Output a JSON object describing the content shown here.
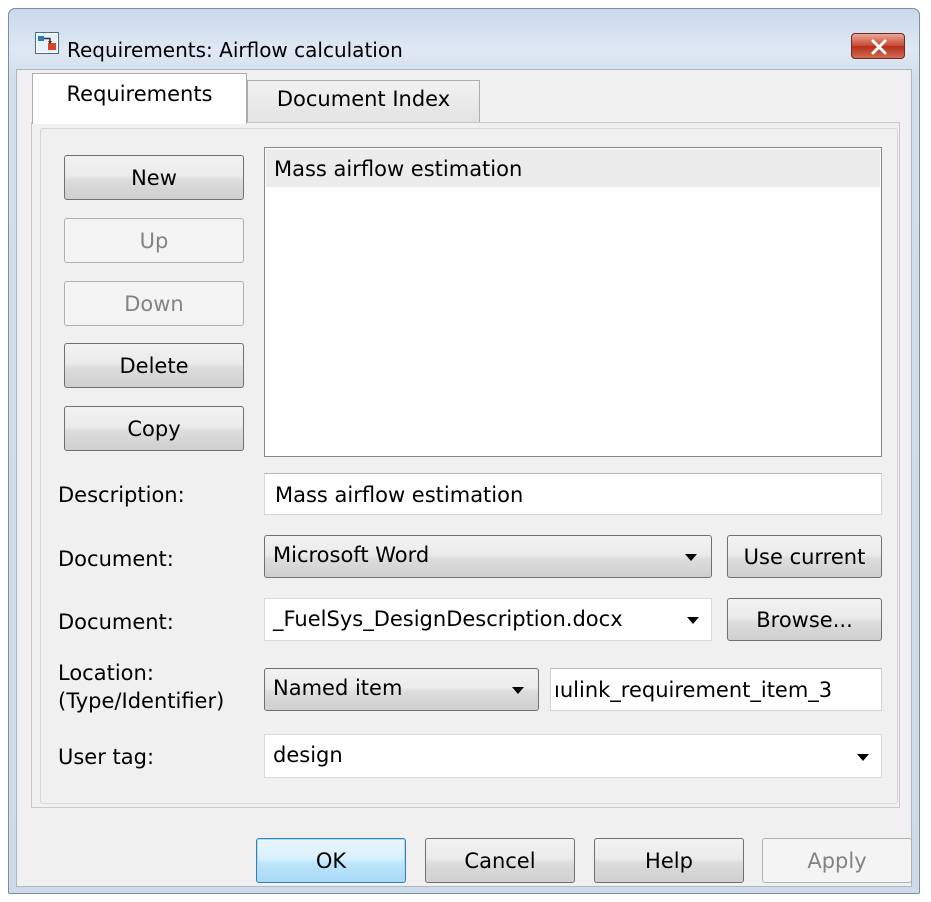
{
  "window": {
    "title": "Requirements: Airflow calculation",
    "close_icon": "close-icon",
    "app_icon": "simulink-model-icon"
  },
  "tabs": [
    {
      "label": "Requirements",
      "active": true
    },
    {
      "label": "Document Index",
      "active": false
    }
  ],
  "side_buttons": {
    "new": "New",
    "up": "Up",
    "down": "Down",
    "delete": "Delete",
    "copy": "Copy"
  },
  "requirements_list": {
    "items": [
      "Mass airflow estimation"
    ],
    "selected_index": 0
  },
  "form": {
    "description_label": "Description:",
    "description_value": "Mass airflow estimation",
    "doc_type_label": "Document:",
    "doc_type_value": "Microsoft Word",
    "use_current_label": "Use current",
    "document_label": "Document:",
    "document_value": "_FuelSys_DesignDescription.docx",
    "browse_label": "Browse...",
    "location_label_line1": "Location:",
    "location_label_line2": "(Type/Identifier)",
    "location_type_value": "Named item",
    "location_id_value": "ıulink_requirement_item_3",
    "user_tag_label": "User tag:",
    "user_tag_value": "design"
  },
  "footer": {
    "ok": "OK",
    "cancel": "Cancel",
    "help": "Help",
    "apply": "Apply"
  },
  "colors": {
    "default_button_border": "#3c7fb1",
    "close_button": "#c9452f"
  }
}
